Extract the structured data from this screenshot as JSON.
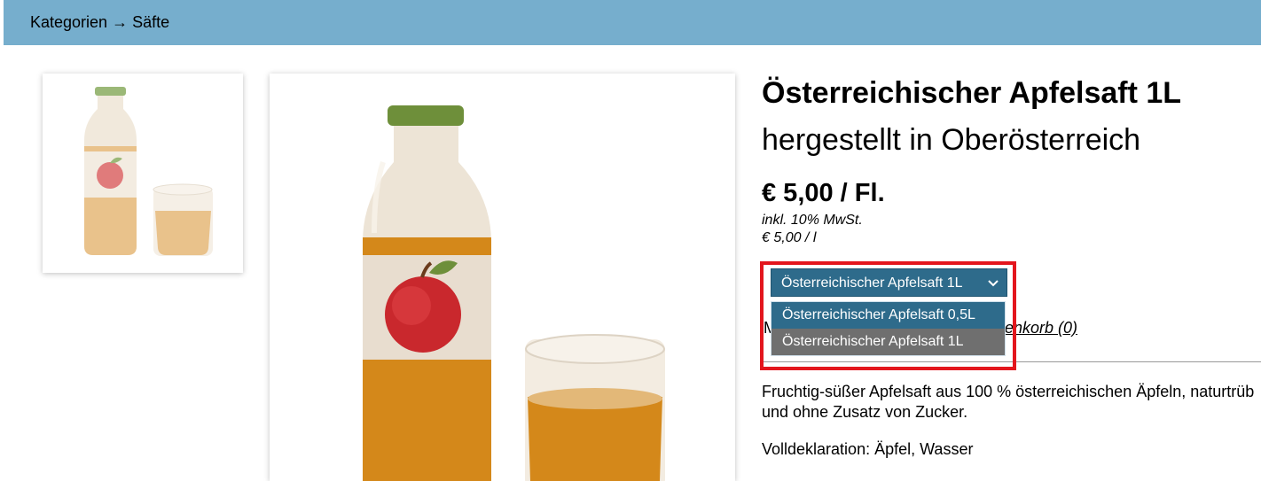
{
  "breadcrumb": {
    "first": "Kategorien",
    "arrow": "→",
    "current": "Säfte"
  },
  "product": {
    "title": "Österreichischer Apfelsaft 1L",
    "subtitle": "hergestellt in Oberösterreich",
    "price": "€ 5,00 / Fl.",
    "vat": "inkl. 10% MwSt.",
    "unit_price": "€ 5,00 / l",
    "description": "Fruchtig-süßer Apfelsaft aus 100 % österreichischen Äpfeln, naturtrüb und ohne Zusatz von Zucker.",
    "declaration": "Volldeklaration: Äpfel, Wasser"
  },
  "variant_select": {
    "selected": "Österreichischer Apfelsaft 1L",
    "options": [
      "Österreichischer Apfelsaft 0,5L",
      "Österreichischer Apfelsaft 1L"
    ]
  },
  "cart": {
    "visible_prefix": "M",
    "link_visible": "renkorb (0)"
  },
  "icons": {
    "select": "chevron-down-icon"
  },
  "colors": {
    "header": "#76aecd",
    "select": "#2e6b8b",
    "highlight": "#e3161d",
    "option_hover": "#6f6f6f"
  }
}
